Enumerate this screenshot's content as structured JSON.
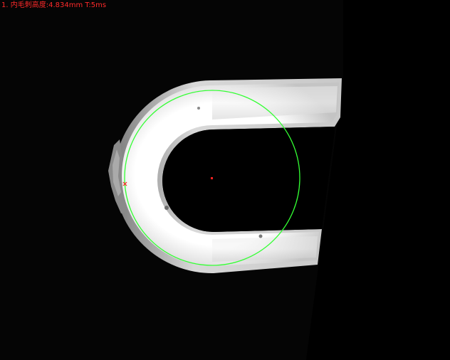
{
  "measurement": {
    "label": "1. 内毛刺高度:4.834mm  T:5ms"
  },
  "colors": {
    "overlay_text": "#ff2a2a",
    "fit_circle": "#33ff33",
    "center_marker": "#ff2020",
    "edge_marker": "#ff2020",
    "part_bright": "#f0f0f0",
    "part_shadow": "#9a9a9a",
    "background": "#000000"
  }
}
